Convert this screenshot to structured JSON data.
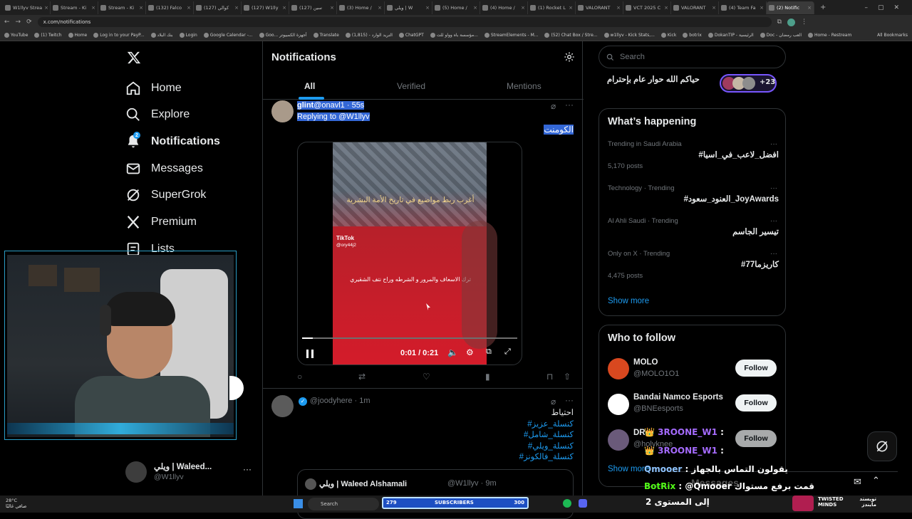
{
  "browser": {
    "tabs": [
      "W1llyv Strea",
      "Stream - Ki",
      "Stream - Ki",
      "(132) Falco",
      "(127) كوالي",
      "(127) W1lly",
      "سين (127)",
      "(3) Home /",
      "ويلي | W",
      "(5) Home /",
      "(4) Home /",
      "(1) Rocket L",
      "VALORANT",
      "VCT 2025 C",
      "VALORANT",
      "(4) Team Fa",
      "(2) Notific"
    ],
    "url": "x.com/notifications",
    "bookmarks": [
      "YouTube",
      "(1) Twitch",
      "Home",
      "Log in to your PayP...",
      "بنك البلاد",
      "Login",
      "Google Calendar -...",
      "Goo... أجهزة الكمبيوتر",
      "Translate",
      "النريد الوارد - (1,815)",
      "ChatGPT",
      "مؤسسة باه وواو للت...",
      "StreamElements - M...",
      "(52) Chat Box / Stre...",
      "w1llyv - Kick Stats,...",
      "Kick",
      "botrix",
      "DokanTIP - الرئيسية",
      "Doc - العب رمضان",
      "Home - Restream"
    ],
    "all_bookmarks": "All Bookmarks"
  },
  "nav": {
    "home": "Home",
    "explore": "Explore",
    "notifications": "Notifications",
    "notifications_badge": "2",
    "messages": "Messages",
    "supergrok": "SuperGrok",
    "premium": "Premium",
    "lists": "Lists",
    "account_name": "ويلي | Waleed...",
    "account_handle": "@W1llyv"
  },
  "main": {
    "title": "Notifications",
    "tabs": [
      "All",
      "Verified",
      "Mentions"
    ],
    "post1": {
      "name": "glint",
      "handle_time": "@onavl1 · 55s",
      "replying": "Replying to @W1llyv",
      "text": "الكومنت",
      "video_caption_top": "أغرب ربط مواضيع في تاريخ الأمة البشرية",
      "video_caption_bottom": "ترك الاسعاف والمرور و الشرطه وراح نتف الشقيري",
      "tiktok": "TikTok",
      "tiktok_user": "@ory44j2",
      "video_time": "0:01 / 0:21",
      "progress": 0.05
    },
    "post2": {
      "handle_time": "@joodyhere · 1m",
      "lines": [
        "احتياط",
        "#كنسلة_عزيز",
        "#كنسلة_شامل",
        "#كنسلة_ويلي",
        "#كنسلة_فالكونز"
      ],
      "quoted_name": "ويلي | Waleed Alshamali",
      "quoted_handle_time": "@W1llyv · 9m"
    }
  },
  "right": {
    "search_placeholder": "Search",
    "space_title": "حياكم الله حوار عام بإحترام",
    "space_count": "+23",
    "whats_happening": "What’s happening",
    "trends": [
      {
        "meta": "Trending in Saudi Arabia",
        "title": "#افضل_لاعب_في_اسيا",
        "posts": "5,170 posts"
      },
      {
        "meta": "Technology · Trending",
        "title": "#العنود_سعود_JoyAwards",
        "posts": ""
      },
      {
        "meta": "Al Ahli Saudi · Trending",
        "title": "تيسير الجاسم",
        "posts": ""
      },
      {
        "meta": "Only on X · Trending",
        "title": "#كاريزما77",
        "posts": "4,475 posts"
      }
    ],
    "show_more": "Show more",
    "who_to_follow": "Who to follow",
    "follow_list": [
      {
        "name": "MOLO",
        "handle": "@MOLO1O1",
        "button": "Follow"
      },
      {
        "name": "Bandai Namco Esports",
        "handle": "@BNEesports",
        "button": "Follow"
      },
      {
        "name": "DR...",
        "handle": "@holyknee",
        "button": "Follow"
      }
    ],
    "show_more2": "Show more",
    "messages": "Messages"
  },
  "overlay": {
    "chat": [
      {
        "user": "3ROONE_W1",
        "text": ":"
      },
      {
        "user": "3ROONE_W1",
        "text": ":"
      },
      {
        "user": "Qmooer",
        "text": ": يقولون التماس بالجهاز"
      },
      {
        "user": "BotRix",
        "text": ": @Qmooer قمت برفع مستواك"
      },
      {
        "user": "",
        "text": "إلى المستوى 2"
      }
    ],
    "subscribers_label": "SUBSCRIBERS",
    "subscribers_count": "279",
    "subscribers_goal": "300",
    "twisted_minds": "TWISTED MINDS",
    "twisted_minds_ar": "تويستد مايندز",
    "search": "Search",
    "weather_temp": "28°C",
    "weather_text": "صافي غالبًا"
  },
  "colors": {
    "accent": "#1d9bf0",
    "bg": "#000000",
    "border": "#2f3336",
    "muted": "#71767b"
  }
}
